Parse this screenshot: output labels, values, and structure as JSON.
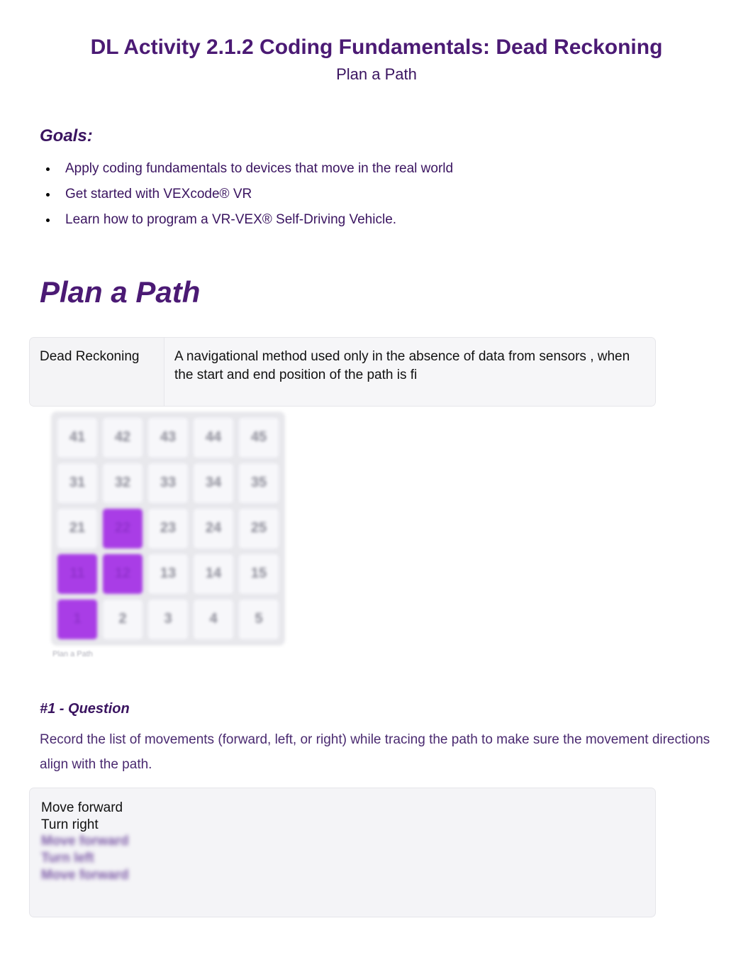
{
  "header": {
    "title": "DL Activity 2.1.2 Coding Fundamentals: Dead Reckoning",
    "subtitle": "Plan a Path"
  },
  "goals": {
    "heading": "Goals:",
    "items": [
      "Apply coding fundamentals to devices that move in the real world",
      "Get started with VEXcode® VR",
      "Learn how to program a VR-VEX® Self-Driving Vehicle."
    ]
  },
  "section_heading": "Plan a Path",
  "definition": {
    "term": "Dead Reckoning",
    "text": "A navigational method used only in the absence of data from sensors , when the start and end position of the path is fi"
  },
  "grid": {
    "caption": "Plan a Path",
    "rows": [
      [
        {
          "v": "41",
          "hl": false
        },
        {
          "v": "42",
          "hl": false
        },
        {
          "v": "43",
          "hl": false
        },
        {
          "v": "44",
          "hl": false
        },
        {
          "v": "45",
          "hl": false
        }
      ],
      [
        {
          "v": "31",
          "hl": false
        },
        {
          "v": "32",
          "hl": false
        },
        {
          "v": "33",
          "hl": false
        },
        {
          "v": "34",
          "hl": false
        },
        {
          "v": "35",
          "hl": false
        }
      ],
      [
        {
          "v": "21",
          "hl": false
        },
        {
          "v": "22",
          "hl": true
        },
        {
          "v": "23",
          "hl": false
        },
        {
          "v": "24",
          "hl": false
        },
        {
          "v": "25",
          "hl": false
        }
      ],
      [
        {
          "v": "11",
          "hl": true
        },
        {
          "v": "12",
          "hl": true
        },
        {
          "v": "13",
          "hl": false
        },
        {
          "v": "14",
          "hl": false
        },
        {
          "v": "15",
          "hl": false
        }
      ],
      [
        {
          "v": "1",
          "hl": true
        },
        {
          "v": "2",
          "hl": false
        },
        {
          "v": "3",
          "hl": false
        },
        {
          "v": "4",
          "hl": false
        },
        {
          "v": "5",
          "hl": false
        }
      ]
    ]
  },
  "question": {
    "heading": "#1 - Question",
    "body": "Record the list of movements (forward, left, or right) while tracing the path to make sure the movement directions align with the path."
  },
  "answer": {
    "visible": [
      "Move forward",
      "Turn right"
    ],
    "blurred": [
      "Move forward",
      "Turn left",
      "Move forward"
    ]
  }
}
